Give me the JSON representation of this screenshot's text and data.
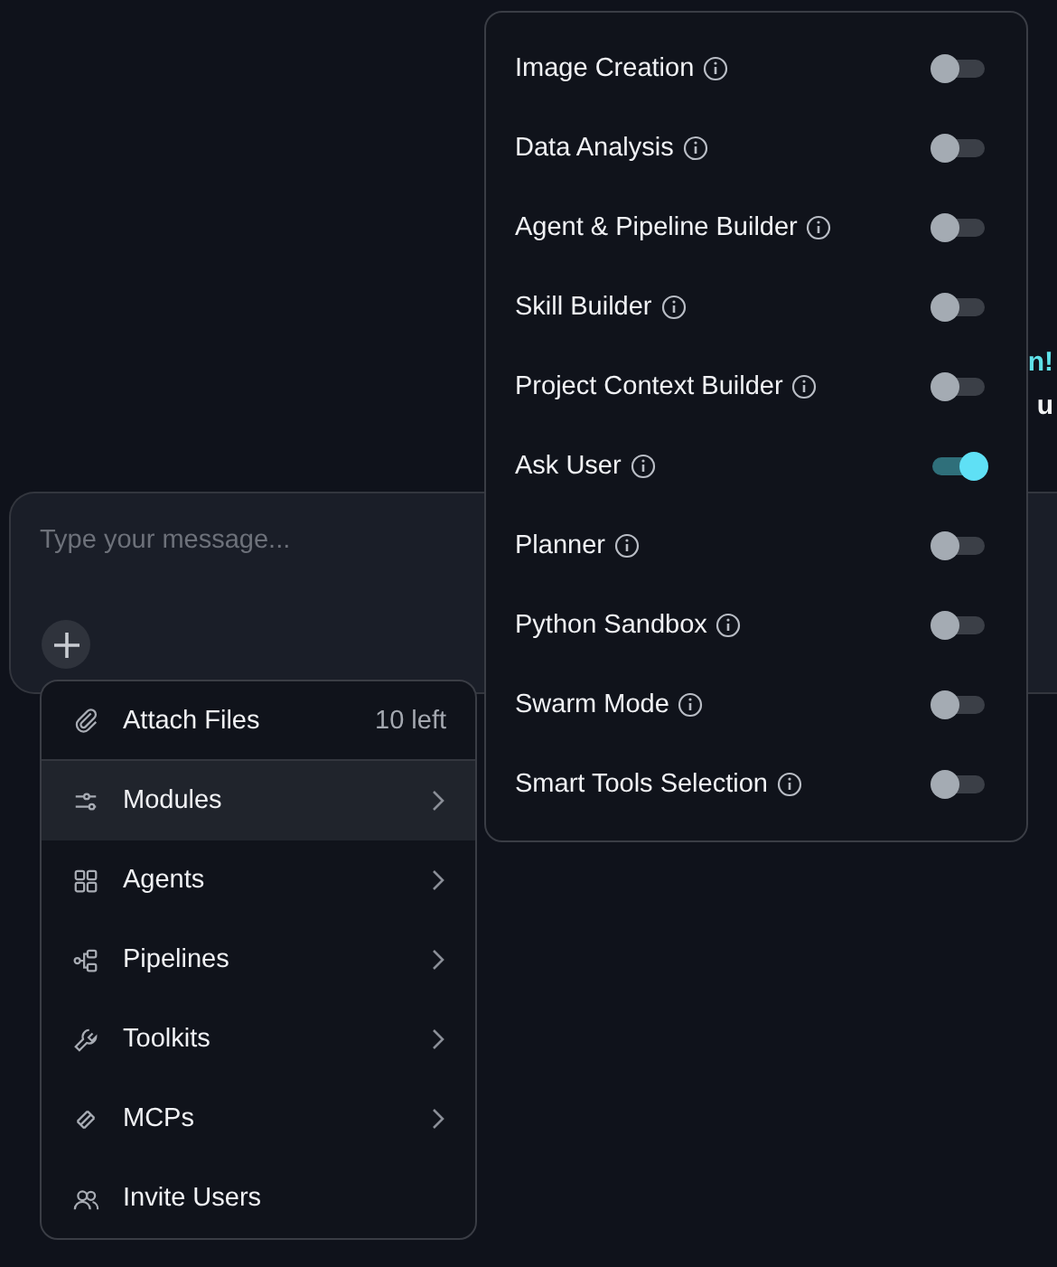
{
  "background_text": [
    {
      "text": "n!",
      "kind": "accent"
    },
    {
      "text": "u",
      "kind": "plain"
    }
  ],
  "composer": {
    "placeholder": "Type your message..."
  },
  "attach_menu": {
    "items": [
      {
        "label": "Attach Files",
        "kind": "count",
        "badge": "10 left",
        "selected": false
      },
      {
        "label": "Modules",
        "kind": "submenu",
        "selected": true
      },
      {
        "label": "Agents",
        "kind": "submenu",
        "selected": false
      },
      {
        "label": "Pipelines",
        "kind": "submenu",
        "selected": false
      },
      {
        "label": "Toolkits",
        "kind": "submenu",
        "selected": false
      },
      {
        "label": "MCPs",
        "kind": "submenu",
        "selected": false
      },
      {
        "label": "Invite Users",
        "kind": "action",
        "selected": false
      }
    ]
  },
  "modules_menu": {
    "items": [
      {
        "label": "Image Creation",
        "on": false
      },
      {
        "label": "Data Analysis",
        "on": false
      },
      {
        "label": "Agent & Pipeline Builder",
        "on": false
      },
      {
        "label": "Skill Builder",
        "on": false
      },
      {
        "label": "Project Context Builder",
        "on": false
      },
      {
        "label": "Ask User",
        "on": true
      },
      {
        "label": "Planner",
        "on": false
      },
      {
        "label": "Python Sandbox",
        "on": false
      },
      {
        "label": "Swarm Mode",
        "on": false
      },
      {
        "label": "Smart Tools Selection",
        "on": false
      }
    ]
  }
}
